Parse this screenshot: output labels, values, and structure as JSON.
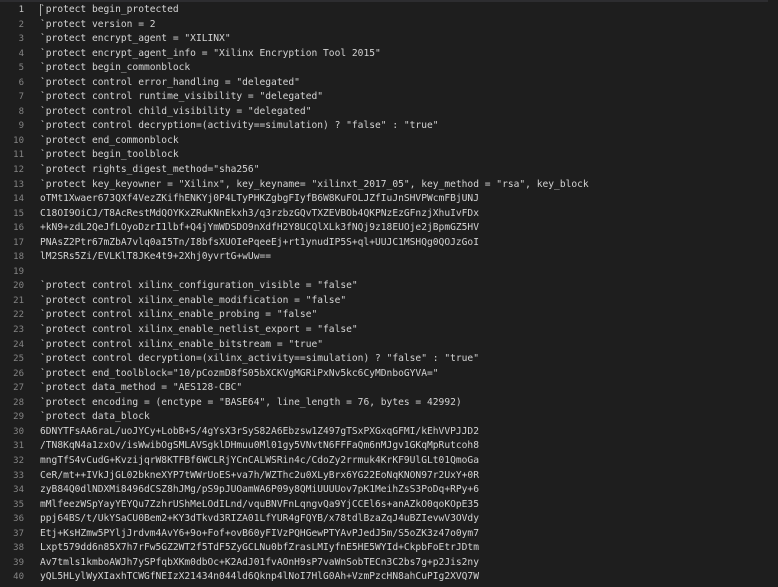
{
  "editor": {
    "lines": [
      {
        "num": "1",
        "text": "`protect begin_protected"
      },
      {
        "num": "2",
        "text": "`protect version = 2"
      },
      {
        "num": "3",
        "text": "`protect encrypt_agent = \"XILINX\""
      },
      {
        "num": "4",
        "text": "`protect encrypt_agent_info = \"Xilinx Encryption Tool 2015\""
      },
      {
        "num": "5",
        "text": "`protect begin_commonblock"
      },
      {
        "num": "6",
        "text": "`protect control error_handling = \"delegated\""
      },
      {
        "num": "7",
        "text": "`protect control runtime_visibility = \"delegated\""
      },
      {
        "num": "8",
        "text": "`protect control child_visibility = \"delegated\""
      },
      {
        "num": "9",
        "text": "`protect control decryption=(activity==simulation) ? \"false\" : \"true\""
      },
      {
        "num": "10",
        "text": "`protect end_commonblock"
      },
      {
        "num": "11",
        "text": "`protect begin_toolblock"
      },
      {
        "num": "12",
        "text": "`protect rights_digest_method=\"sha256\""
      },
      {
        "num": "13",
        "text": "`protect key_keyowner = \"Xilinx\", key_keyname= \"xilinxt_2017_05\", key_method = \"rsa\", key_block"
      },
      {
        "num": "14",
        "text": "oTMt1Xwaer673QXf4VezZKifhENKYj0P4LTyPHKZgbgFIyfB6W8KuFOLJZfIuJnSHVPWcmFBjUNJ"
      },
      {
        "num": "15",
        "text": "C18OI9OiCJ/T8AcRestMdQOYKxZRuKNnEkxh3/q3rzbzGQvTXZEVBOb4QKPNzEzGFnzjXhuIvFDx"
      },
      {
        "num": "16",
        "text": "+kN9+zdL2QeJfLOyoDzrI1lbf+Q4jYmWDSDO9nXdfH2Y8UCQlXLk3fNQj9z18EUOje2jBpmGZ5HV"
      },
      {
        "num": "17",
        "text": "PNAsZ2Ptr67mZbA7vlq0aI5Tn/I8bfsXUOIePqeeEj+rt1ynudIP5S+ql+UUJC1MSHQg0QOJzGoI"
      },
      {
        "num": "18",
        "text": "lM2SRs5Zi/EVLKlT8JKe4t9+2Xhj0yvrtG+wUw=="
      },
      {
        "num": "19",
        "text": ""
      },
      {
        "num": "20",
        "text": "`protect control xilinx_configuration_visible = \"false\""
      },
      {
        "num": "21",
        "text": "`protect control xilinx_enable_modification = \"false\""
      },
      {
        "num": "22",
        "text": "`protect control xilinx_enable_probing = \"false\""
      },
      {
        "num": "23",
        "text": "`protect control xilinx_enable_netlist_export = \"false\""
      },
      {
        "num": "24",
        "text": "`protect control xilinx_enable_bitstream = \"true\""
      },
      {
        "num": "25",
        "text": "`protect control decryption=(xilinx_activity==simulation) ? \"false\" : \"true\""
      },
      {
        "num": "26",
        "text": "`protect end_toolblock=\"10/pCozmD8fS05bXCKVgMGRiPxNv5kc6CyMDnboGYVA=\""
      },
      {
        "num": "27",
        "text": "`protect data_method = \"AES128-CBC\""
      },
      {
        "num": "28",
        "text": "`protect encoding = (enctype = \"BASE64\", line_length = 76, bytes = 42992)"
      },
      {
        "num": "29",
        "text": "`protect data_block"
      },
      {
        "num": "30",
        "text": "6DNYTFsAA6raL/uoJYCy+LobB+S/4gYsX3rSyS82A6Ebzsw1Z497gTSxPXGxqGFMI/kEhVVPJJD2"
      },
      {
        "num": "31",
        "text": "/TN8KqN4a1zxOv/isWwibOgSMLAVSgklDHmuu0Ml01gy5VNvtN6FFFaQm6nMJgv1GKqMpRutcoh8"
      },
      {
        "num": "32",
        "text": "mngTfS4vCudG+KvzijqrW8KTFBf6WCLRjYCnCALWSRin4c/CdoZy2rrmuk4KrKF9UlGLt01QmoGa"
      },
      {
        "num": "33",
        "text": "CeR/mt++IVkJjGL02bkneXYP7tWWrUoES+va7h/WZThc2u0XLyBrx6YG22EoNqKNON97r2UxY+0R"
      },
      {
        "num": "34",
        "text": "zyB84Q0dlNDXMi8496dCSZ8hJMg/pS9pJUOamWA6P09y8QMiUUUUov7pK1MeihZsS3PoDq+RPy+6"
      },
      {
        "num": "35",
        "text": "mMlfeezWSpYayYEYQu7ZzhrUShMeLOdILnd/vquBNVFnLqngvQa9YjCCEl6s+anAZkO0qoKOpE35"
      },
      {
        "num": "36",
        "text": "ppj64BS/t/UkYSaCU0Bem2+KY3dTkvd3RIZA01LfYUR4gFQYB/x78tdlBzaZqJ4uBZIevwV3OVdy"
      },
      {
        "num": "37",
        "text": "Etj+KsHZmw5PYljJrdvm4AvY6+9o+Fof+ovB60yFIVzPQHGewPTYAvPJedJ5m/S5oZK3z47o0ym7"
      },
      {
        "num": "38",
        "text": "Lxpt579dd6n85X7h7rFw5GZ2WT2f5TdF5ZyGCLNu0bfZrasLMIyfnE5HE5WYId+CkpbFoEtrJDtm"
      },
      {
        "num": "39",
        "text": "Av7tmls1kmboAWJh7ySPfqbXKm0dbOc+K2AdJ01fvAOnH9sP7vaWnSobTECn3C2bs7g+p2Jis2ny"
      },
      {
        "num": "40",
        "text": "yQL5HLylWyXIaxhTCWGfNEIzX21434n044ld6Qknp4lNoI7HlG0Ah+VzmPzcHN8ahCuPIg2XVQ7W"
      }
    ]
  }
}
